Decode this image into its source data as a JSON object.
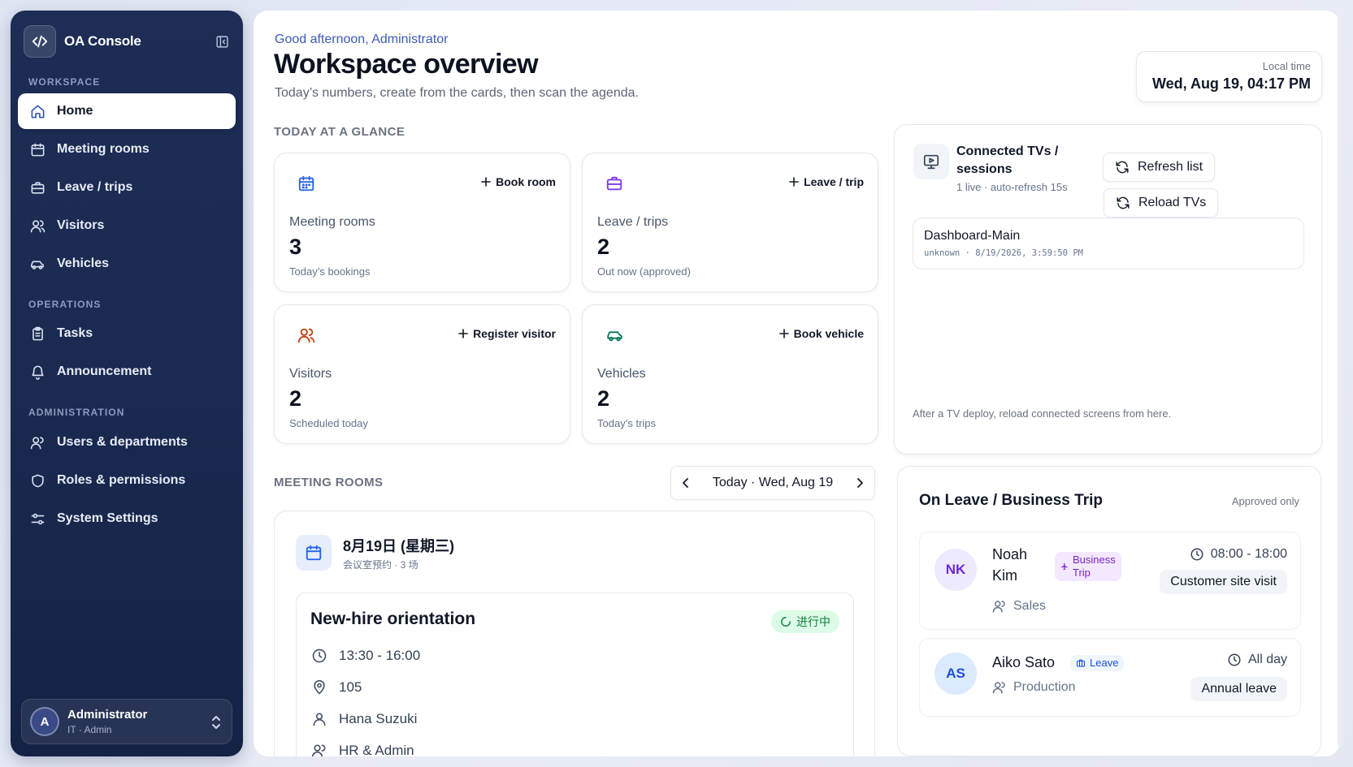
{
  "sidebar": {
    "brand": "OA Console",
    "sections": {
      "workspace": "WORKSPACE",
      "operations": "OPERATIONS",
      "administration": "ADMINISTRATION"
    },
    "items": [
      {
        "label": "Home",
        "icon": "home-icon"
      },
      {
        "label": "Meeting rooms",
        "icon": "calendar-icon"
      },
      {
        "label": "Leave / trips",
        "icon": "briefcase-icon"
      },
      {
        "label": "Visitors",
        "icon": "users-icon"
      },
      {
        "label": "Vehicles",
        "icon": "car-icon"
      },
      {
        "label": "Tasks",
        "icon": "clipboard-icon"
      },
      {
        "label": "Announcement",
        "icon": "bell-icon"
      },
      {
        "label": "Users & departments",
        "icon": "user-icon"
      },
      {
        "label": "Roles & permissions",
        "icon": "shield-icon"
      },
      {
        "label": "System Settings",
        "icon": "sliders-icon"
      }
    ],
    "user": {
      "initial": "A",
      "name": "Administrator",
      "role": "IT · Admin"
    }
  },
  "header": {
    "greeting": "Good afternoon, Administrator",
    "title": "Workspace overview",
    "subtitle": "Today’s numbers, create from the cards, then scan the agenda.",
    "clock_label": "Local time",
    "clock_value": "Wed, Aug 19, 04:17 PM"
  },
  "glance": {
    "title": "TODAY AT A GLANCE",
    "cards": [
      {
        "label": "Meeting rooms",
        "value": "3",
        "sub": "Today’s bookings",
        "action": "Book room",
        "icon": "calendar-icon",
        "color": "#2563eb"
      },
      {
        "label": "Leave / trips",
        "value": "2",
        "sub": "Out now (approved)",
        "action": "Leave / trip",
        "icon": "briefcase-icon",
        "color": "#7c3aed"
      },
      {
        "label": "Visitors",
        "value": "2",
        "sub": "Scheduled today",
        "action": "Register visitor",
        "icon": "users-icon",
        "color": "#c2410c"
      },
      {
        "label": "Vehicles",
        "value": "2",
        "sub": "Today’s trips",
        "action": "Book vehicle",
        "icon": "car-icon",
        "color": "#047857"
      }
    ]
  },
  "tv": {
    "title": "Connected TVs / sessions",
    "sub": "1 live · auto-refresh 15s",
    "refresh_label": "Refresh list",
    "reload_label": "Reload TVs",
    "sessions": [
      {
        "name": "Dashboard-Main",
        "meta": "unknown · 8/19/2026, 3:59:50 PM"
      }
    ],
    "footer": "After a TV deploy, reload connected screens from here."
  },
  "rooms": {
    "title": "MEETING ROOMS",
    "date_label": "Today · Wed, Aug 19",
    "day_title": "8月19日 (星期三)",
    "day_sub": "会议室预约 · 3 场",
    "meeting": {
      "title": "New-hire orientation",
      "status": "进行中",
      "time": "13:30 - 16:00",
      "room": "105",
      "host": "Hana Suzuki",
      "dept": "HR & Admin"
    }
  },
  "leave": {
    "title": "On Leave / Business Trip",
    "note": "Approved only",
    "people": [
      {
        "initials": "NK",
        "name_line1": "Noah",
        "name_line2": "Kim",
        "type_line1": "Business",
        "type_line2": "Trip",
        "dept": "Sales",
        "time": "08:00 - 18:00",
        "reason": "Customer site visit"
      },
      {
        "initials": "AS",
        "name": "Aiko Sato",
        "type": "Leave",
        "dept": "Production",
        "time": "All day",
        "reason": "Annual leave"
      }
    ]
  }
}
